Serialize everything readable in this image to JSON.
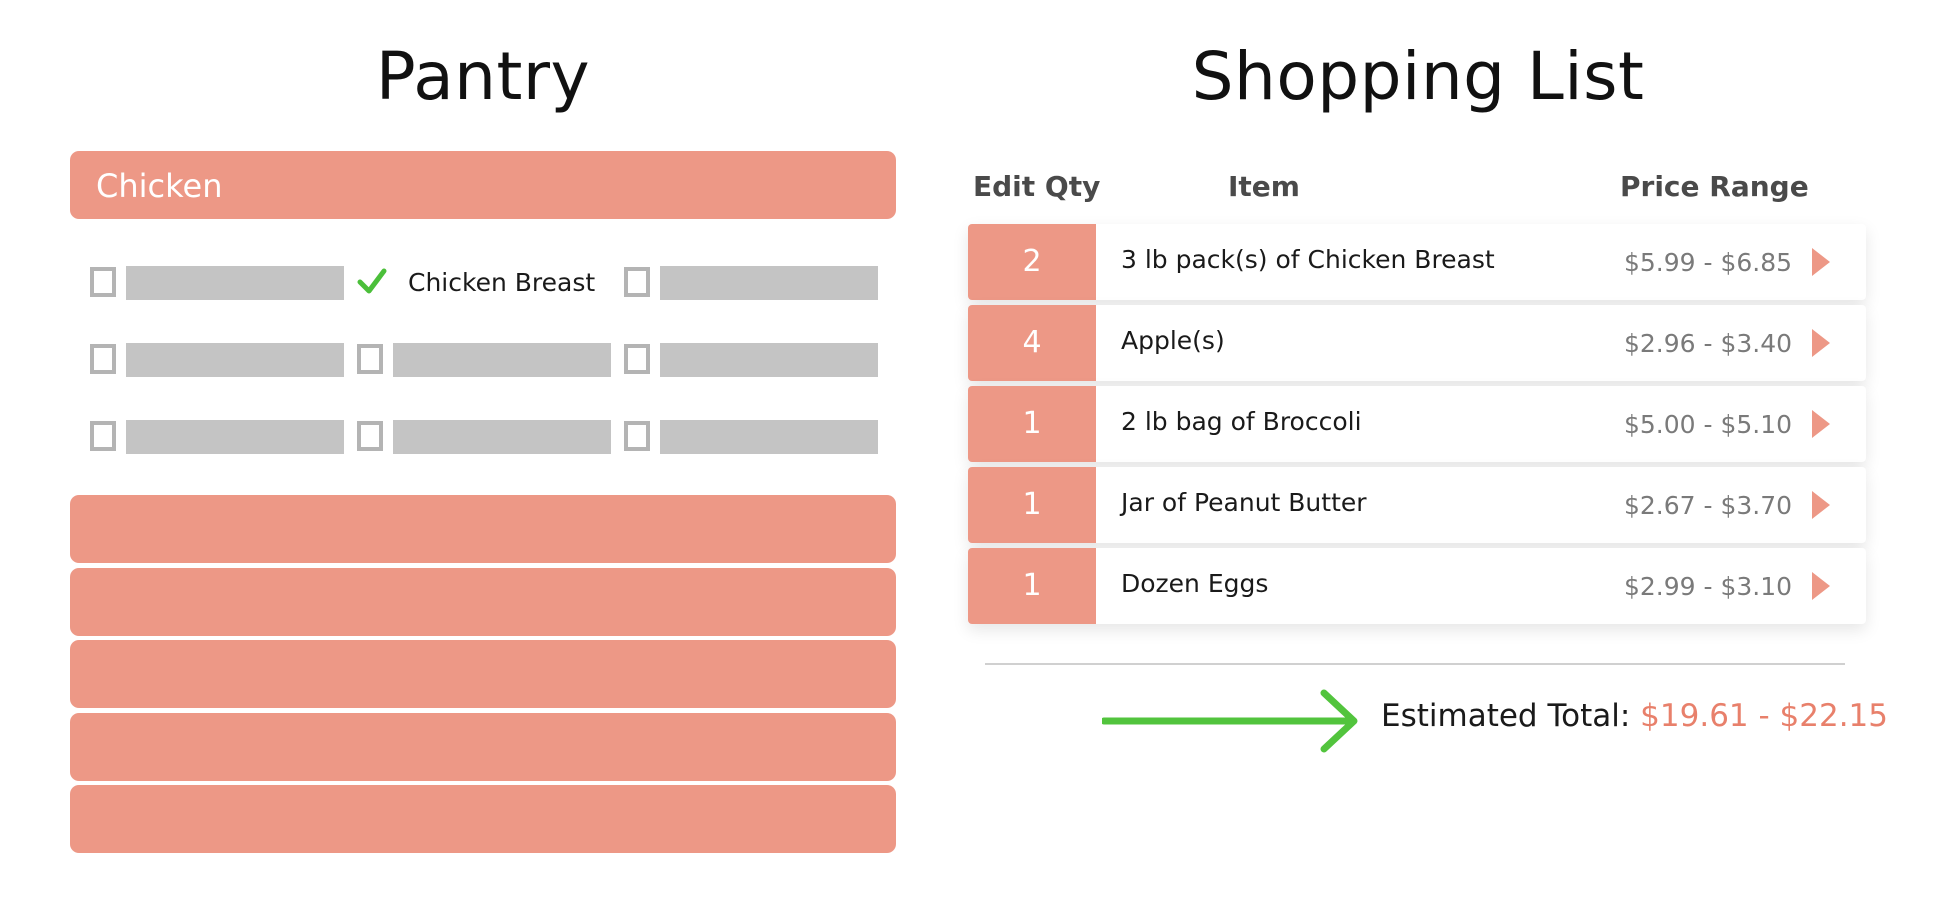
{
  "pantry": {
    "title": "Pantry",
    "category": "Chicken",
    "checked_item": "Chicken Breast",
    "collapsed_categories": 5
  },
  "shopping_list": {
    "title": "Shopping List",
    "headers": {
      "qty": "Edit Qty",
      "item": "Item",
      "price": "Price Range"
    },
    "rows": [
      {
        "qty": "2",
        "item": "3 lb pack(s) of Chicken Breast",
        "price": "$5.99 - $6.85"
      },
      {
        "qty": "4",
        "item": "Apple(s)",
        "price": "$2.96 - $3.40"
      },
      {
        "qty": "1",
        "item": "2 lb bag of Broccoli",
        "price": "$5.00 - $5.10"
      },
      {
        "qty": "1",
        "item": "Jar of Peanut Butter",
        "price": "$2.67 - $3.70"
      },
      {
        "qty": "1",
        "item": "Dozen Eggs",
        "price": "$2.99 - $3.10"
      }
    ],
    "total_label": "Estimated Total:",
    "total_value": "$19.61 - $22.15"
  },
  "colors": {
    "accent": "#ed9886",
    "placeholder": "#c4c4c4",
    "check": "#4bbf3a",
    "arrow": "#52c43d",
    "total": "#e8806b"
  },
  "icons": {
    "check": "check-icon",
    "row_arrow": "play-arrow-icon",
    "pointer": "right-arrow-icon"
  }
}
